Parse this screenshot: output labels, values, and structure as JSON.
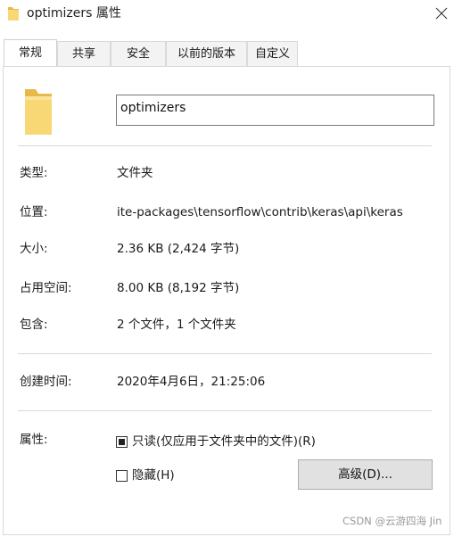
{
  "window": {
    "title": "optimizers 属性",
    "title_icon": "folder-icon",
    "close_icon": "close-icon"
  },
  "tabs": [
    {
      "label": "常规",
      "active": true
    },
    {
      "label": "共享",
      "active": false
    },
    {
      "label": "安全",
      "active": false
    },
    {
      "label": "以前的版本",
      "active": false
    },
    {
      "label": "自定义",
      "active": false
    }
  ],
  "general": {
    "folder_icon": "folder-icon",
    "name": "optimizers",
    "type_label": "类型:",
    "type_value": "文件夹",
    "location_label": "位置:",
    "location_value": "ite-packages\\tensorflow\\contrib\\keras\\api\\keras",
    "size_label": "大小:",
    "size_value": "2.36 KB (2,424 字节)",
    "size_on_disk_label": "占用空间:",
    "size_on_disk_value": "8.00 KB (8,192 字节)",
    "contains_label": "包含:",
    "contains_value": "2 个文件，1 个文件夹",
    "created_label": "创建时间:",
    "created_value": "2020年4月6日，21:25:06",
    "attributes_label": "属性:",
    "readonly_label": "只读(仅应用于文件夹中的文件)(R)",
    "readonly_state": "indeterminate",
    "hidden_label": "隐藏(H)",
    "hidden_state": "unchecked",
    "advanced_button": "高级(D)..."
  },
  "colors": {
    "folder_yellow": "#F8D775",
    "folder_dark": "#E8B84A",
    "button_face": "#E1E1E1",
    "border": "#D9D9D9"
  },
  "watermark": "CSDN @云游四海 Jin"
}
